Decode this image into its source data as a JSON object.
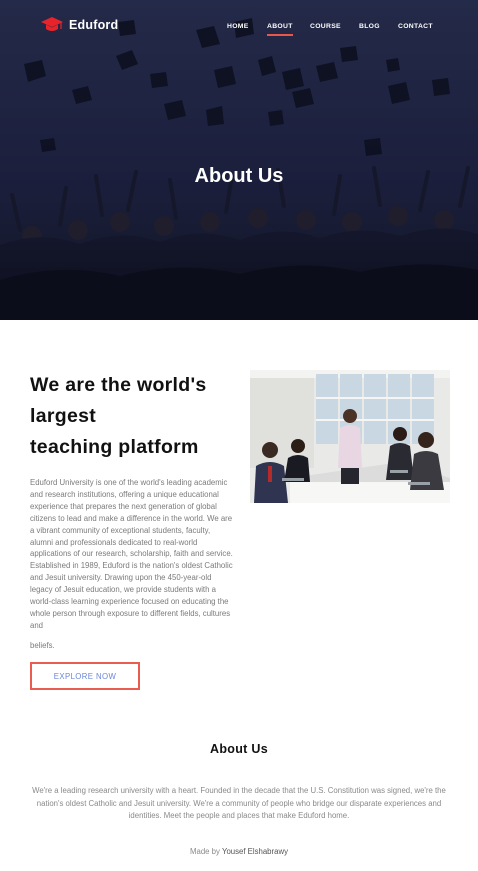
{
  "brand": {
    "name": "Eduford",
    "logo_icon": "graduation-cap-icon",
    "logo_color": "#e8242a"
  },
  "nav": {
    "items": [
      {
        "label": "HOME"
      },
      {
        "label": "ABOUT",
        "active": true
      },
      {
        "label": "COURSE"
      },
      {
        "label": "BLOG"
      },
      {
        "label": "CONTACT"
      }
    ],
    "active_underline_color": "#e8584a"
  },
  "hero": {
    "title": "About Us"
  },
  "about_section": {
    "headline": [
      "We are the world's",
      "largest",
      "teaching platform"
    ],
    "description": "Eduford University is one of the world's leading academic and research institutions, offering a unique educational experience that prepares the next generation of global citizens to lead and make a difference in the world. We are a vibrant community of exceptional students, faculty, alumni and professionals dedicated to real-world applications of our research, scholarship, faith and service. Established in 1989, Eduford is the nation's oldest Catholic and Jesuit university. Drawing upon the 450-year-old legacy of Jesuit education, we provide students with a world-class learning experience focused on educating the whole person through exposure to different fields, cultures and",
    "description_end": "beliefs.",
    "button_label": "EXPLORE NOW",
    "button_border_color": "#e95c4f"
  },
  "about_us": {
    "heading": "About Us",
    "text": "We're a leading research university with a heart. Founded in the decade that the U.S. Constitution was signed, we're the nation's oldest Catholic and Jesuit university. We're a community of people who bridge our disparate experiences and identities. Meet the people and places that make Eduford home."
  },
  "footer": {
    "prefix": "Made by",
    "author": "Yousef Elshabrawy"
  }
}
